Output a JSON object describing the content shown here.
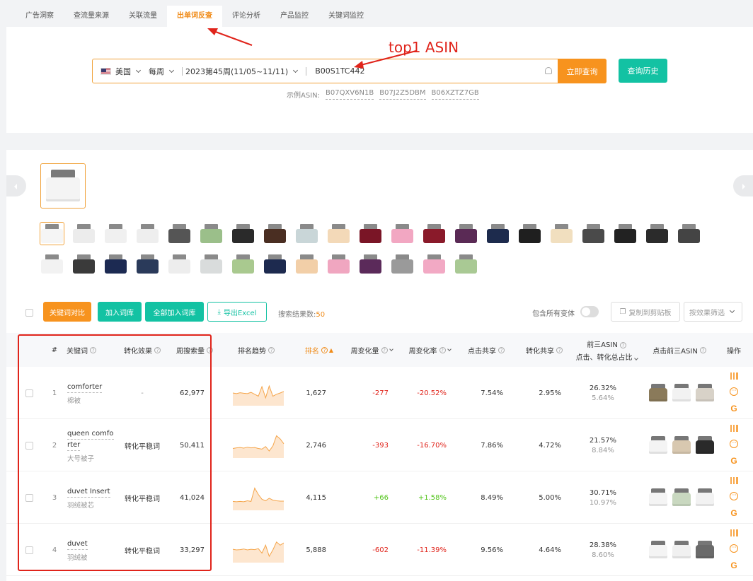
{
  "tabs": [
    {
      "label": "广告洞察"
    },
    {
      "label": "查流量来源"
    },
    {
      "label": "关联流量"
    },
    {
      "label": "出单词反查"
    },
    {
      "label": "评论分析"
    },
    {
      "label": "产品监控"
    },
    {
      "label": "关键词监控"
    }
  ],
  "search": {
    "country": "美国",
    "period": "每周",
    "week": "2023第45周(11/05~11/11)",
    "asin_value": "B00S1TC442",
    "query_label": "立即查询",
    "history_label": "查询历史",
    "examples_label": "示例ASIN:",
    "examples": [
      "B07QXV6N1B",
      "B07J2Z5DBM",
      "B06XZTZ7GB"
    ]
  },
  "annotation": {
    "text": "top1 ASIN"
  },
  "toolbar": {
    "compare_label": "关键词对比",
    "add_label": "加入词库",
    "add_all_label": "全部加入词库",
    "export_label": "导出Excel",
    "result_label": "搜索结果数:",
    "result_count": "50",
    "variant_label": "包含所有变体",
    "copy_label": "复制到剪贴板",
    "filter_label": "按效果筛选"
  },
  "table": {
    "headers": {
      "index": "#",
      "keyword": "关键词",
      "conversion": "转化效果",
      "volume": "周搜索量",
      "trend": "排名趋势",
      "rank": "排名",
      "weekly_change": "周变化量",
      "weekly_rate": "周变化率",
      "click_share": "点击共享",
      "conv_share": "转化共享",
      "top3_line1": "前三ASIN",
      "top3_line2": "点击、转化总占比",
      "top3_click": "点击前三ASIN",
      "actions": "操作"
    },
    "rows": [
      {
        "index": "1",
        "keyword": "comforter",
        "keyword_line2": "",
        "translation": "棉被",
        "conversion": "-",
        "volume": "62,977",
        "rank": "1,627",
        "change": "-277",
        "rate": "-20.52%",
        "click_share": "7.54%",
        "conv_share": "2.95%",
        "top3_click": "26.32%",
        "top3_conv": "5.64%",
        "trend": [
          40,
          38,
          41,
          39,
          38,
          42,
          36,
          30,
          60,
          25,
          62,
          30,
          36,
          40,
          45
        ]
      },
      {
        "index": "2",
        "keyword": "queen comfo",
        "keyword_line2": "rter",
        "translation": "大号被子",
        "conversion": "转化平稳词",
        "volume": "50,411",
        "rank": "2,746",
        "change": "-393",
        "rate": "-16.70%",
        "click_share": "7.86%",
        "conv_share": "4.72%",
        "top3_click": "21.57%",
        "top3_conv": "8.84%",
        "trend": [
          30,
          32,
          33,
          31,
          34,
          32,
          33,
          30,
          28,
          36,
          22,
          38,
          70,
          60,
          45
        ]
      },
      {
        "index": "3",
        "keyword": "duvet Insert",
        "keyword_line2": "",
        "translation": "羽绒被芯",
        "conversion": "转化平稳词",
        "volume": "41,024",
        "rank": "4,115",
        "change": "+66",
        "rate": "+1.58%",
        "click_share": "8.49%",
        "conv_share": "5.00%",
        "top3_click": "30.71%",
        "top3_conv": "10.97%",
        "trend": [
          28,
          27,
          28,
          27,
          30,
          28,
          70,
          50,
          35,
          30,
          38,
          32,
          30,
          29,
          29
        ]
      },
      {
        "index": "4",
        "keyword": "duvet",
        "keyword_line2": "",
        "translation": "羽绒被",
        "conversion": "转化平稳词",
        "volume": "33,297",
        "rank": "5,888",
        "change": "-602",
        "rate": "-11.39%",
        "click_share": "9.56%",
        "conv_share": "4.64%",
        "top3_click": "28.38%",
        "top3_conv": "8.60%",
        "trend": [
          42,
          40,
          41,
          43,
          40,
          42,
          41,
          44,
          30,
          55,
          20,
          40,
          65,
          55,
          62
        ]
      }
    ]
  },
  "colors": {
    "accent": "#f7931e",
    "teal": "#13c2a3",
    "negative": "#e0241b",
    "positive": "#52c41a"
  },
  "variant_colors": [
    "#f5f5f5",
    "#ececec",
    "#f0f0f0",
    "#eeeeee",
    "#555555",
    "#9bbf8a",
    "#2a2a2a",
    "#4a2e22",
    "#c9d6d8",
    "#f3d9b8",
    "#7a1526",
    "#f2a7c2",
    "#8a1a2a",
    "#5a2a55",
    "#1d2b4d",
    "#1f1f1f",
    "#f1dfbf",
    "#4a4a4a",
    "#222222",
    "#2b2b2b",
    "#444444",
    "#f2f2f2",
    "#3a3a3a",
    "#1c2a52",
    "#2a3a5a",
    "#ededed",
    "#d9dcdc",
    "#a9c98f",
    "#1d2a4f",
    "#f2cfa8",
    "#f0a6c0",
    "#5b2a5a",
    "#9a9a9a",
    "#f2a9c4",
    "#a9c994"
  ]
}
